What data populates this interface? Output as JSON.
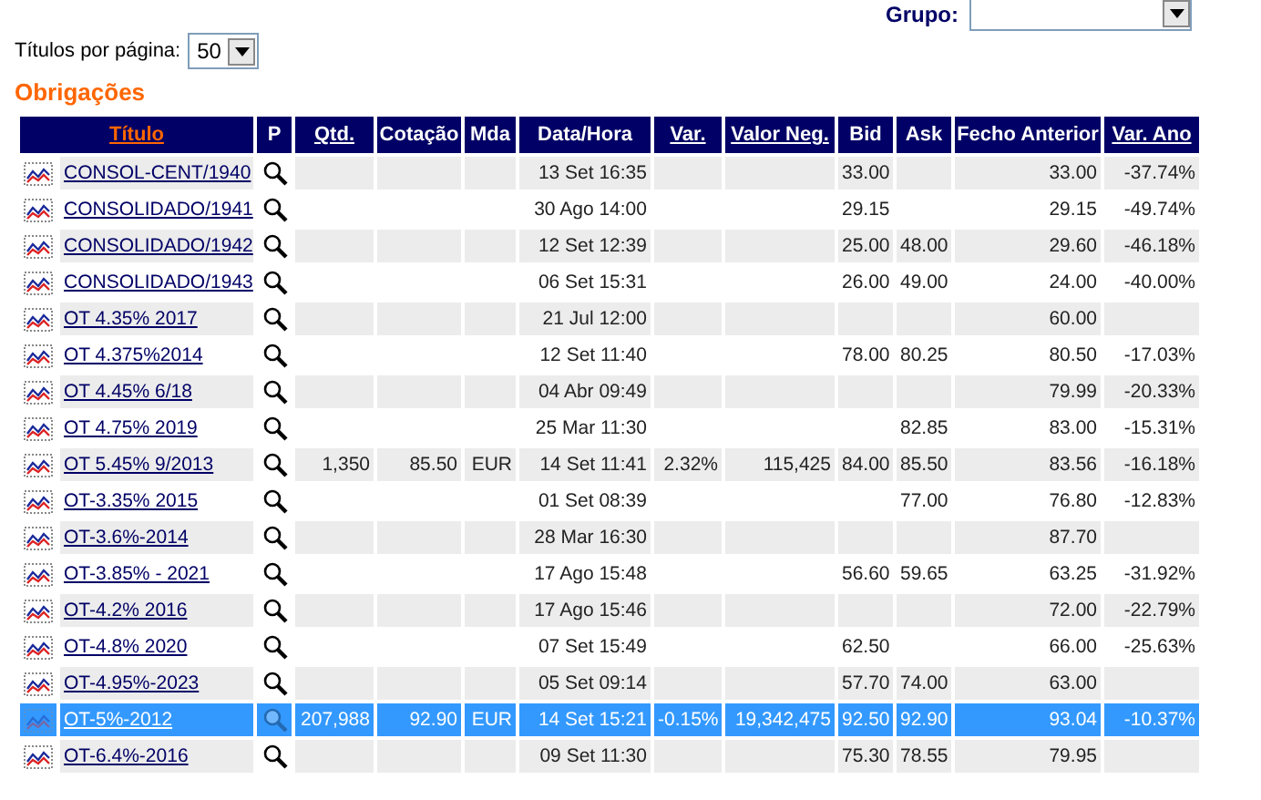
{
  "group_filter": {
    "label": "Grupo:"
  },
  "page_size": {
    "label": "Títulos por página:",
    "value": "50"
  },
  "section_title": "Obrigações",
  "table": {
    "columns": [
      {
        "label": "Título",
        "sortable": true,
        "selected": true
      },
      {
        "label": "P",
        "sortable": false,
        "selected": false
      },
      {
        "label": "Qtd.",
        "sortable": true,
        "selected": false
      },
      {
        "label": "Cotação",
        "sortable": false,
        "selected": false
      },
      {
        "label": "Mda",
        "sortable": false,
        "selected": false
      },
      {
        "label": "Data/Hora",
        "sortable": false,
        "selected": false
      },
      {
        "label": "Var.",
        "sortable": true,
        "selected": false
      },
      {
        "label": "Valor Neg.",
        "sortable": true,
        "selected": false
      },
      {
        "label": "Bid",
        "sortable": false,
        "selected": false
      },
      {
        "label": "Ask",
        "sortable": false,
        "selected": false
      },
      {
        "label": "Fecho Anterior",
        "sortable": false,
        "selected": false
      },
      {
        "label": "Var. Ano",
        "sortable": true,
        "selected": false
      }
    ],
    "rows": [
      {
        "title": "CONSOL-CENT/1940",
        "date_time": "13 Set 16:35",
        "bid": "33.00",
        "previous_close": "33.00",
        "var_year": "-37.74%",
        "selected": false
      },
      {
        "title": "CONSOLIDADO/1941",
        "date_time": "30 Ago 14:00",
        "bid": "29.15",
        "previous_close": "29.15",
        "var_year": "-49.74%",
        "selected": false
      },
      {
        "title": "CONSOLIDADO/1942",
        "date_time": "12 Set 12:39",
        "bid": "25.00",
        "ask": "48.00",
        "previous_close": "29.60",
        "var_year": "-46.18%",
        "selected": false
      },
      {
        "title": "CONSOLIDADO/1943",
        "date_time": "06 Set 15:31",
        "bid": "26.00",
        "ask": "49.00",
        "previous_close": "24.00",
        "var_year": "-40.00%",
        "selected": false
      },
      {
        "title": "OT 4.35% 2017",
        "date_time": "21 Jul 12:00",
        "previous_close": "60.00",
        "selected": false
      },
      {
        "title": "OT 4.375%2014",
        "date_time": "12 Set 11:40",
        "bid": "78.00",
        "ask": "80.25",
        "previous_close": "80.50",
        "var_year": "-17.03%",
        "selected": false
      },
      {
        "title": "OT 4.45% 6/18",
        "date_time": "04 Abr 09:49",
        "previous_close": "79.99",
        "var_year": "-20.33%",
        "selected": false
      },
      {
        "title": "OT 4.75% 2019",
        "date_time": "25 Mar 11:30",
        "ask": "82.85",
        "previous_close": "83.00",
        "var_year": "-15.31%",
        "selected": false
      },
      {
        "title": "OT 5.45% 9/2013",
        "qty": "1,350",
        "price": "85.50",
        "currency": "EUR",
        "date_time": "14 Set 11:41",
        "var": "2.32%",
        "value_traded": "115,425",
        "bid": "84.00",
        "ask": "85.50",
        "previous_close": "83.56",
        "var_year": "-16.18%",
        "selected": false
      },
      {
        "title": "OT-3.35% 2015",
        "date_time": "01 Set 08:39",
        "ask": "77.00",
        "previous_close": "76.80",
        "var_year": "-12.83%",
        "selected": false
      },
      {
        "title": "OT-3.6%-2014",
        "date_time": "28 Mar 16:30",
        "previous_close": "87.70",
        "selected": false
      },
      {
        "title": "OT-3.85% - 2021",
        "date_time": "17 Ago 15:48",
        "bid": "56.60",
        "ask": "59.65",
        "previous_close": "63.25",
        "var_year": "-31.92%",
        "selected": false
      },
      {
        "title": "OT-4.2% 2016",
        "date_time": "17 Ago 15:46",
        "previous_close": "72.00",
        "var_year": "-22.79%",
        "selected": false
      },
      {
        "title": "OT-4.8% 2020",
        "date_time": "07 Set 15:49",
        "bid": "62.50",
        "previous_close": "66.00",
        "var_year": "-25.63%",
        "selected": false
      },
      {
        "title": "OT-4.95%-2023",
        "date_time": "05 Set 09:14",
        "bid": "57.70",
        "ask": "74.00",
        "previous_close": "63.00",
        "selected": false
      },
      {
        "title": "OT-5%-2012",
        "qty": "207,988",
        "price": "92.90",
        "currency": "EUR",
        "date_time": "14 Set 15:21",
        "var": "-0.15%",
        "value_traded": "19,342,475",
        "bid": "92.50",
        "ask": "92.90",
        "previous_close": "93.04",
        "var_year": "-10.37%",
        "selected": true
      },
      {
        "title": "OT-6.4%-2016",
        "date_time": "09 Set 11:30",
        "bid": "75.30",
        "ask": "78.55",
        "previous_close": "79.95",
        "selected": false
      }
    ]
  }
}
